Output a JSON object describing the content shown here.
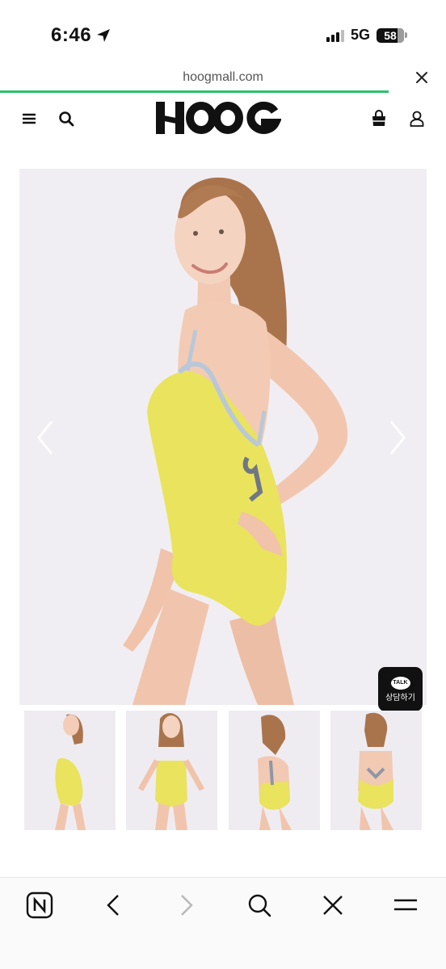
{
  "status_bar": {
    "time": "6:46",
    "network": "5G",
    "battery": "58"
  },
  "browser": {
    "url": "hoogmall.com"
  },
  "site": {
    "logo_text": "HOOG"
  },
  "gallery": {
    "thumbnail_count": 4
  },
  "chat_button": {
    "badge": "TALK",
    "label": "상담하기"
  },
  "toolbar": {
    "items": [
      "naver-home",
      "back",
      "forward",
      "search",
      "close",
      "menu"
    ]
  },
  "colors": {
    "progress": "#2bc26b",
    "swimsuit": "#e9e35e",
    "trim": "#b9c8d8",
    "background": "#f1eef3"
  }
}
